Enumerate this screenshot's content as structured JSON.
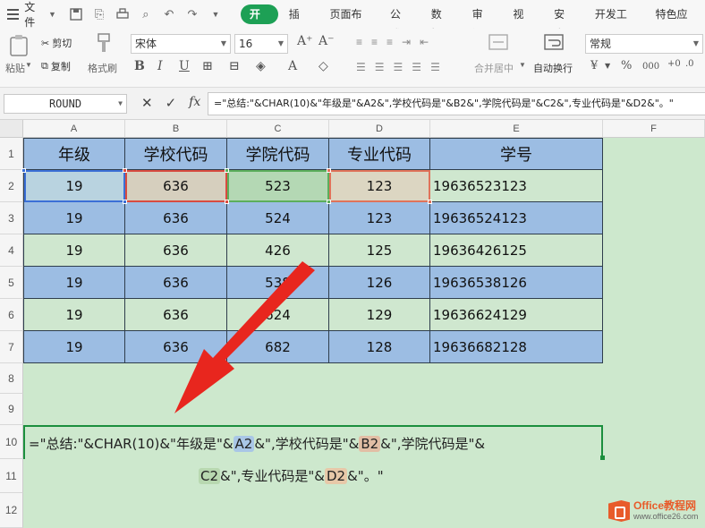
{
  "menubar": {
    "file_label": "文件",
    "tabs": [
      "开始",
      "插入",
      "页面布局",
      "公式",
      "数据",
      "审阅",
      "视图",
      "安全",
      "开发工具",
      "特色应用"
    ]
  },
  "toolbar": {
    "paste_label": "粘贴",
    "cut_label": "剪切",
    "copy_label": "复制",
    "format_painter_label": "格式刷",
    "font_name": "宋体",
    "font_size": "16",
    "merge_label": "合并居中",
    "wrap_label": "自动换行",
    "number_format": "常规",
    "percent": "%",
    "thousands": "000"
  },
  "formula_bar": {
    "name_box": "ROUND",
    "formula": "=\"总结:\"&CHAR(10)&\"年级是\"&A2&\",学校代码是\"&B2&\",学院代码是\"&C2&\",专业代码是\"&D2&\"。\""
  },
  "sheet": {
    "columns": [
      "A",
      "B",
      "C",
      "D",
      "E",
      "F"
    ],
    "rows": [
      "1",
      "2",
      "3",
      "4",
      "5",
      "6",
      "7",
      "8",
      "9",
      "10",
      "11",
      "12"
    ],
    "header": [
      "年级",
      "学校代码",
      "学院代码",
      "专业代码",
      "学号"
    ],
    "data": [
      [
        "19",
        "636",
        "523",
        "123",
        "19636523123"
      ],
      [
        "19",
        "636",
        "524",
        "123",
        "19636524123"
      ],
      [
        "19",
        "636",
        "426",
        "125",
        "19636426125"
      ],
      [
        "19",
        "636",
        "538",
        "126",
        "19636538126"
      ],
      [
        "19",
        "636",
        "624",
        "129",
        "19636624129"
      ],
      [
        "19",
        "636",
        "682",
        "128",
        "19636682128"
      ]
    ]
  },
  "edit_formula": {
    "p1": "=\"总结:\"&CHAR(10)&\"年级是\"&",
    "r1": "A2",
    "p2": "&\",学校代码是\"&",
    "r2": "B2",
    "p3": "&\",学院代码是\"&",
    "r3": "C2",
    "p4": "&\",专业代码是\"&",
    "r4": "D2",
    "p5": "&\"。\""
  },
  "watermark": {
    "line1": "Office教程网",
    "line2": "www.office26.com"
  },
  "colors": {
    "accent_green": "#1da055",
    "arrow_red": "#e8261e",
    "header_blue": "#9cbde3",
    "row_green": "#cfe7cf"
  }
}
